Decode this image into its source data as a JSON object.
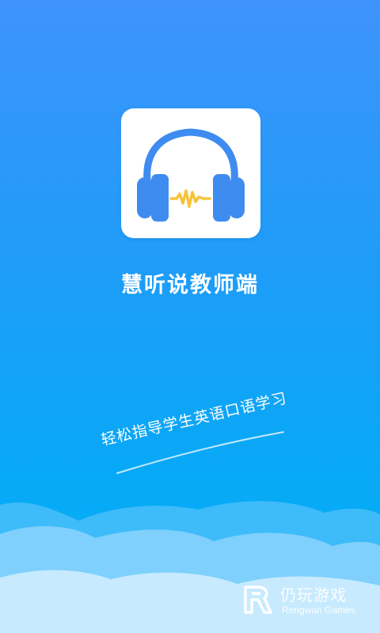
{
  "app": {
    "name": "慧听说教师端",
    "slogan": "轻松指导学生英语口语学习"
  },
  "watermark": {
    "cn": "仍玩游戏",
    "en": "Rengwan Games"
  },
  "icons": {
    "app_icon": "headphones-icon",
    "watermark_logo": "rengwan-logo-icon"
  },
  "colors": {
    "background_top": "#3f93fb",
    "background_bottom": "#04b0f4",
    "headphone_blue": "#3f8cf0",
    "wave_yellow": "#f5c33b",
    "cloud_light": "#bfe6ff"
  }
}
